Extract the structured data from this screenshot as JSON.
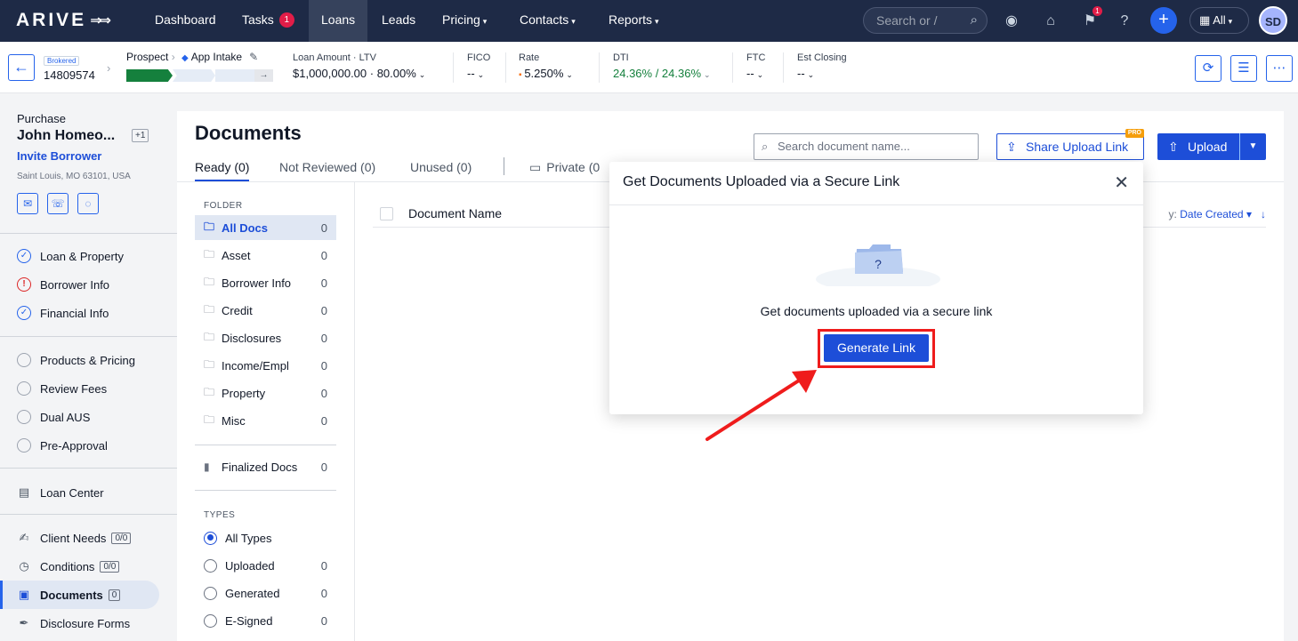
{
  "nav": {
    "logo": "ARIVE",
    "items": [
      {
        "label": "Dashboard"
      },
      {
        "label": "Tasks",
        "badge": "1"
      },
      {
        "label": "Loans",
        "active": true
      },
      {
        "label": "Leads"
      },
      {
        "label": "Pricing"
      },
      {
        "label": "Contacts"
      },
      {
        "label": "Reports"
      }
    ],
    "search_placeholder": "Search or /",
    "notif_count": "1",
    "scope": "All",
    "avatar_initials": "SD"
  },
  "loan": {
    "tag": "Brokered",
    "number": "14809574",
    "stage": "Prospect",
    "substage": "App Intake",
    "fields": [
      {
        "label": "Loan Amount · LTV",
        "value": "$1,000,000.00 · 80.00%"
      },
      {
        "label": "FICO",
        "value": "--"
      },
      {
        "label": "Rate",
        "value": "5.250%"
      },
      {
        "label": "DTI",
        "value": "24.36% / 24.36%"
      },
      {
        "label": "FTC",
        "value": "--"
      },
      {
        "label": "Est Closing",
        "value": "--"
      }
    ]
  },
  "borrower": {
    "purpose": "Purchase",
    "name": "John Homeo...",
    "extra": "+1",
    "invite": "Invite Borrower",
    "address": "Saint Louis, MO 63101, USA"
  },
  "sidebar": {
    "steps": [
      {
        "label": "Loan & Property",
        "status": "done"
      },
      {
        "label": "Borrower Info",
        "status": "warn"
      },
      {
        "label": "Financial Info",
        "status": "done"
      }
    ],
    "flow": [
      {
        "label": "Products & Pricing"
      },
      {
        "label": "Review Fees"
      },
      {
        "label": "Dual AUS"
      },
      {
        "label": "Pre-Approval"
      }
    ],
    "loan_center": "Loan Center",
    "tools": [
      {
        "label": "Client Needs",
        "count": "0/0"
      },
      {
        "label": "Conditions",
        "count": "0/0"
      },
      {
        "label": "Documents",
        "count": "0"
      },
      {
        "label": "Disclosure Forms"
      }
    ]
  },
  "documents": {
    "title": "Documents",
    "tabs": [
      "Ready (0)",
      "Not Reviewed (0)",
      "Unused (0)",
      "Private (0"
    ],
    "search_placeholder": "Search document name...",
    "share_label": "Share Upload Link",
    "pro_tag": "PRO",
    "upload_label": "Upload",
    "folder_header": "FOLDER",
    "folders": [
      {
        "label": "All Docs",
        "count": "0"
      },
      {
        "label": "Asset",
        "count": "0"
      },
      {
        "label": "Borrower Info",
        "count": "0"
      },
      {
        "label": "Credit",
        "count": "0"
      },
      {
        "label": "Disclosures",
        "count": "0"
      },
      {
        "label": "Income/Empl",
        "count": "0"
      },
      {
        "label": "Property",
        "count": "0"
      },
      {
        "label": "Misc",
        "count": "0"
      }
    ],
    "finalized": {
      "label": "Finalized Docs",
      "count": "0"
    },
    "types_header": "TYPES",
    "types": [
      {
        "label": "All Types",
        "count": ""
      },
      {
        "label": "Uploaded",
        "count": "0"
      },
      {
        "label": "Generated",
        "count": "0"
      },
      {
        "label": "E-Signed",
        "count": "0"
      }
    ],
    "column_name": "Document Name",
    "sort_prefix": "y:",
    "sort_label": "Date Created"
  },
  "modal": {
    "title": "Get Documents Uploaded via a Secure Link",
    "message": "Get documents uploaded via a secure link",
    "button": "Generate Link",
    "illus_mark": "?"
  },
  "colors": {
    "nav_bg": "#1e2a46",
    "accent": "#1d4ed8",
    "highlight": "#ef1c1c",
    "progress_done": "#15803d"
  }
}
